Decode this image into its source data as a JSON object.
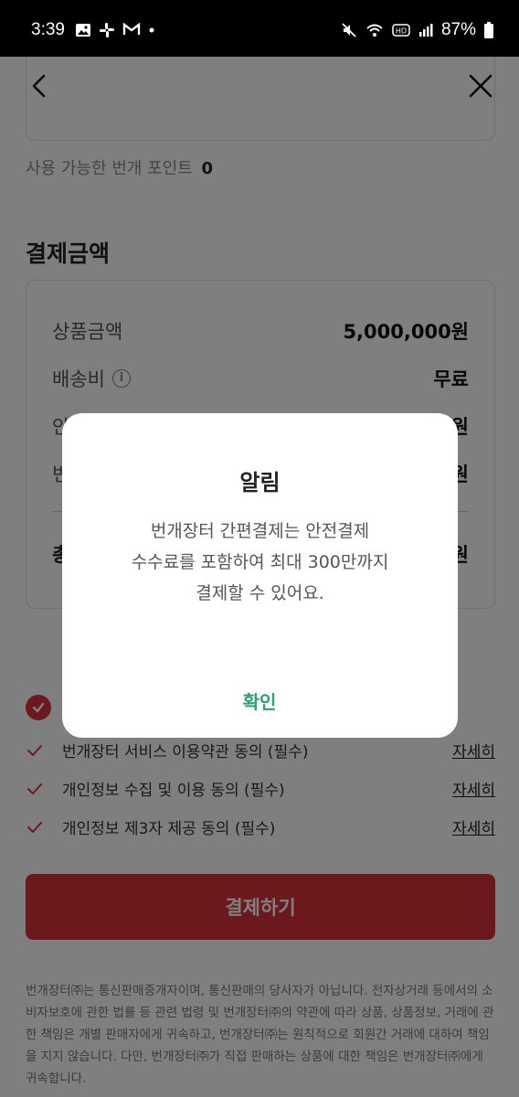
{
  "status": {
    "time": "3:39",
    "battery": "87%",
    "left_icons": [
      "image-icon",
      "slack-icon",
      "gmail-icon",
      "dot-icon"
    ],
    "right_icons": [
      "mute-icon",
      "wifi-icon",
      "hd-icon",
      "signal-icon",
      "battery-icon"
    ]
  },
  "points": {
    "label": "사용 가능한 번개 포인트",
    "value": "0"
  },
  "payment": {
    "title": "결제금액",
    "rows": [
      {
        "label": "상품금액",
        "value": "5,000,000원"
      },
      {
        "label": "배송비",
        "value": "무료"
      },
      {
        "label": "안",
        "value": "원"
      },
      {
        "label": "번",
        "value": "원"
      }
    ],
    "total": {
      "label": "총",
      "value": "원"
    }
  },
  "agreements": {
    "all": "",
    "items": [
      {
        "label": "번개장터 서비스 이용약관 동의 (필수)",
        "link": "자세히"
      },
      {
        "label": "개인정보 수집 및 이용 동의 (필수)",
        "link": "자세히"
      },
      {
        "label": "개인정보 제3자 제공 동의 (필수)",
        "link": "자세히"
      }
    ]
  },
  "pay_button": "결제하기",
  "footer": "번개장터㈜는 통신판매중개자이며, 통신판매의 당사자가 아닙니다. 전자상거래 등에서의 소비자보호에 관한 법률 등 관련 법령 및 번개장터㈜의 약관에 따라 상품, 상품정보, 거래에 관한 책임은 개별 판매자에게 귀속하고, 번개장터㈜는 원칙적으로 회원간 거래에 대하여 책임을 지지 않습니다. 다만, 번개장터㈜가 직접 판매하는 상품에 대한 책임은 번개장터㈜에게 귀속합니다.",
  "dialog": {
    "title": "알림",
    "lines": [
      "번개장터 간편결제는 안전결제",
      "수수료를 포함하여 최대 300만까지",
      "결제할 수 있어요."
    ],
    "ok": "확인"
  },
  "colors": {
    "accent": "#d9333a",
    "ok": "#2e9e7a"
  }
}
